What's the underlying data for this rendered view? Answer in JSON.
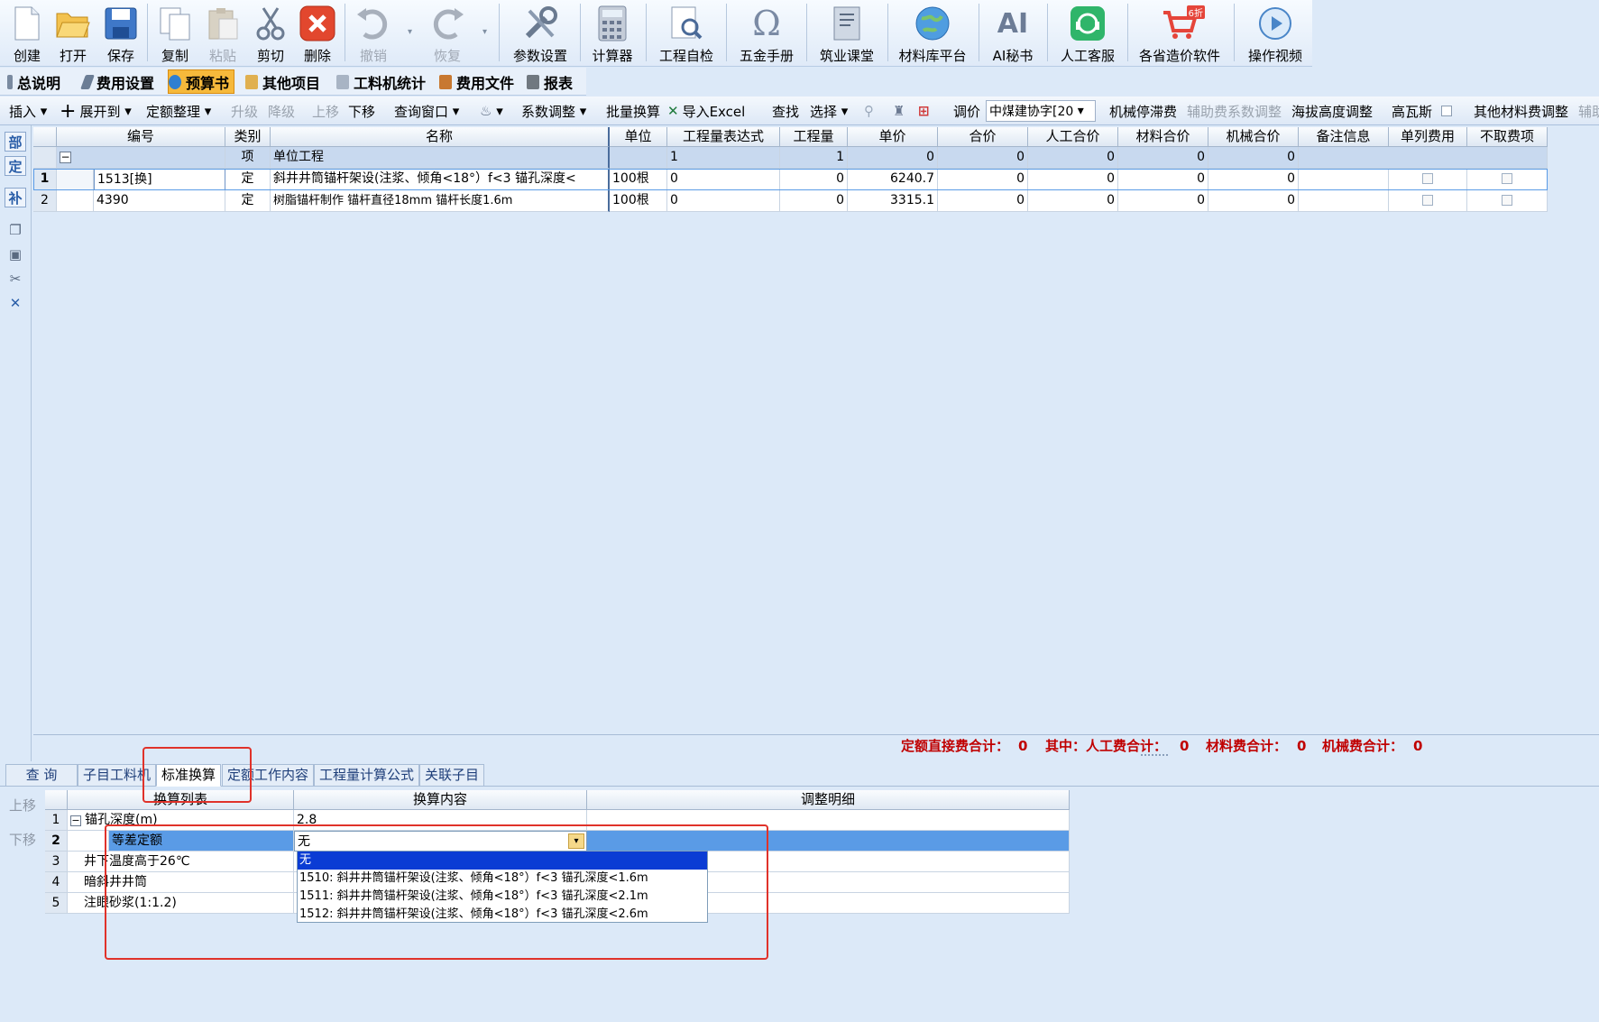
{
  "toolbar": [
    {
      "label": "创建",
      "icon": "new-file-icon"
    },
    {
      "label": "打开",
      "icon": "open-folder-icon"
    },
    {
      "label": "保存",
      "icon": "save-disk-icon"
    },
    {
      "label": "复制",
      "icon": "copy-icon"
    },
    {
      "label": "粘贴",
      "icon": "paste-icon",
      "disabled": true
    },
    {
      "label": "剪切",
      "icon": "scissors-icon"
    },
    {
      "label": "删除",
      "icon": "delete-icon"
    },
    {
      "label": "撤销",
      "icon": "undo-icon",
      "disabled": true
    },
    {
      "label": "恢复",
      "icon": "redo-icon",
      "disabled": true
    },
    {
      "label": "参数设置",
      "icon": "tools-icon"
    },
    {
      "label": "计算器",
      "icon": "calculator-icon"
    },
    {
      "label": "工程自检",
      "icon": "inspect-icon"
    },
    {
      "label": "五金手册",
      "icon": "omega-icon"
    },
    {
      "label": "筑业课堂",
      "icon": "book-icon"
    },
    {
      "label": "材料库平台",
      "icon": "globe-icon"
    },
    {
      "label": "AI秘书",
      "icon": "ai-icon"
    },
    {
      "label": "人工客服",
      "icon": "headset-icon"
    },
    {
      "label": "各省造价软件",
      "icon": "cart-icon",
      "badge": "6折"
    },
    {
      "label": "操作视频",
      "icon": "play-icon"
    }
  ],
  "main_tabs": [
    "总说明",
    "费用设置",
    "预算书",
    "其他项目",
    "工料机统计",
    "费用文件",
    "报表"
  ],
  "active_main_tab": "预算书",
  "row3": {
    "insert": "插入",
    "expand": "展开到",
    "quota_sort": "定额整理",
    "upgrade": "升级",
    "downgrade": "降级",
    "move_up": "上移",
    "move_down": "下移",
    "query_window": "查询窗口",
    "coef_adjust": "系数调整",
    "batch_convert": "批量换算",
    "import_excel": "导入Excel",
    "find": "查找",
    "select": "选择",
    "adjust_price": "调价",
    "price_select": "中煤建协字[20",
    "machine_stop": "机械停滞费",
    "aux_coef": "辅助费系数调整",
    "altitude": "海拔高度调整",
    "gas": "高瓦斯",
    "other_material": "其他材料费调整",
    "aux_more": "辅助"
  },
  "left_strip": [
    "部",
    "定",
    "补"
  ],
  "grid": {
    "headers": [
      "编号",
      "类别",
      "名称",
      "单位",
      "工程量表达式",
      "工程量",
      "单价",
      "合价",
      "人工合价",
      "材料合价",
      "机械合价",
      "备注信息",
      "单列费用",
      "不取费项"
    ],
    "group_row": {
      "type": "项",
      "name": "单位工程",
      "expr": "1",
      "qty": "1",
      "price": "0",
      "total": "0",
      "labor": "0",
      "material": "0",
      "machine": "0"
    },
    "rows": [
      {
        "no": "1",
        "code": "1513[换]",
        "type": "定",
        "name": "斜井井筒锚杆架设(注浆、倾角<18°）f<3 锚孔深度<",
        "unit": "100根",
        "expr": "0",
        "qty": "0",
        "price": "6240.7",
        "total": "0",
        "labor": "0",
        "material": "0",
        "machine": "0"
      },
      {
        "no": "2",
        "code": "4390",
        "type": "定",
        "name": "树脂锚杆制作 锚杆直径18mm 锚杆长度1.6m",
        "unit": "100根",
        "expr": "0",
        "qty": "0",
        "price": "3315.1",
        "total": "0",
        "labor": "0",
        "material": "0",
        "machine": "0"
      }
    ]
  },
  "summary": {
    "quota_direct": "定额直接费合计：",
    "quota_direct_v": "0",
    "of_which": "其中：人工费合计：",
    "labor_v": "0",
    "material": "材料费合计：",
    "material_v": "0",
    "machine": "机械费合计：",
    "machine_v": "0"
  },
  "bottom_tabs": [
    "查 询",
    "子目工料机",
    "标准换算",
    "定额工作内容",
    "工程量计算公式",
    "关联子目"
  ],
  "active_bottom_tab": "标准换算",
  "side_buttons": {
    "up": "上移",
    "down": "下移"
  },
  "conv": {
    "headers": [
      "换算列表",
      "换算内容",
      "调整明细"
    ],
    "rows": [
      {
        "no": "1",
        "name": "锚孔深度(m)",
        "content": "2.8"
      },
      {
        "no": "2",
        "name": "等差定额",
        "content": "无"
      },
      {
        "no": "3",
        "name": "井下温度高于26℃",
        "content": ""
      },
      {
        "no": "4",
        "name": "暗斜井井筒",
        "content": ""
      },
      {
        "no": "5",
        "name": "注眼砂浆(1:1.2)",
        "content": ""
      }
    ],
    "dropdown": [
      "无",
      "1510: 斜井井筒锚杆架设(注浆、倾角<18°）f<3 锚孔深度<1.6m",
      "1511: 斜井井筒锚杆架设(注浆、倾角<18°）f<3 锚孔深度<2.1m",
      "1512: 斜井井筒锚杆架设(注浆、倾角<18°）f<3 锚孔深度<2.6m"
    ]
  },
  "colors": {
    "accent_red": "#e0322a",
    "active_tab": "#f6b93b",
    "selection": "#0a3cd4",
    "row_highlight": "#5a9be6"
  }
}
